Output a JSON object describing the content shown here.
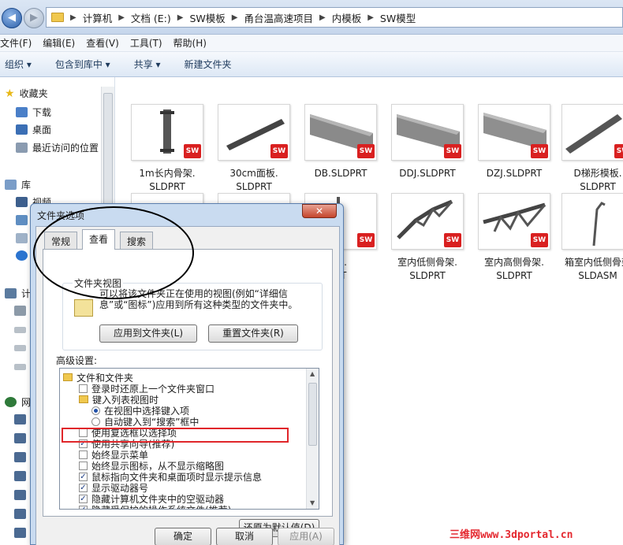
{
  "address": {
    "crumbs": [
      "计算机",
      "文档 (E:)",
      "SW模板",
      "甬台温高速项目",
      "内模板",
      "SW模型"
    ]
  },
  "menu": [
    "文件(F)",
    "编辑(E)",
    "查看(V)",
    "工具(T)",
    "帮助(H)"
  ],
  "toolbar": [
    "组织 ▾",
    "包含到库中 ▾",
    "共享 ▾",
    "新建文件夹"
  ],
  "nav": {
    "favorites": "收藏夹",
    "downloads": "下载",
    "desktop": "桌面",
    "recent": "最近访问的位置",
    "libraries": "库",
    "videos": "视频",
    "computer": "计",
    "network": "网"
  },
  "files": [
    {
      "line1": "1m长内骨架.",
      "line2": "SLDPRT"
    },
    {
      "line1": "30cm面板.",
      "line2": "SLDPRT"
    },
    {
      "line1": "DB.SLDPRT",
      "line2": ""
    },
    {
      "line1": "DDJ.SLDPRT",
      "line2": ""
    },
    {
      "line1": "DZJ.SLDPRT",
      "line2": ""
    },
    {
      "line1": "D梯形模板.",
      "line2": "SLDPRT"
    },
    {
      "line1": "架.",
      "line2": "RT"
    },
    {
      "line1": "室内低侧骨架.",
      "line2": "SLDPRT"
    },
    {
      "line1": "室内高侧骨架.",
      "line2": "SLDPRT"
    },
    {
      "line1": "箱室内低侧骨架",
      "line2": "SLDASM"
    }
  ],
  "badge": "SW",
  "dialog": {
    "title": "文件夹选项",
    "close": "✕",
    "tabs": [
      "常规",
      "查看",
      "搜索"
    ],
    "group_title": "文件夹视图",
    "group_desc": "可以将该文件夹正在使用的视图(例如“详细信息”或“图标”)应用到所有这种类型的文件夹中。",
    "apply_btn": "应用到文件夹(L)",
    "reset_btn": "重置文件夹(R)",
    "advanced": "高级设置:",
    "tree": {
      "root": "文件和文件夹",
      "r1": "登录时还原上一个文件夹窗口",
      "r2": "键入列表视图时",
      "r3": "在视图中选择键入项",
      "r4": "自动键入到“搜索”框中",
      "r5": "使用复选框以选择项",
      "r6": "使用共享向导(推荐)",
      "r7": "始终显示菜单",
      "r8": "始终显示图标，从不显示缩略图",
      "r9": "鼠标指向文件夹和桌面项时显示提示信息",
      "r10": "显示驱动器号",
      "r11": "隐藏计算机文件夹中的空驱动器",
      "r12": "隐藏受保护的操作系统文件(推荐)"
    },
    "restore_btn": "还原为默认值(D)",
    "ok": "确定",
    "cancel": "取消",
    "apply": "应用(A)"
  },
  "watermark": "三维网www.3dportal.cn"
}
